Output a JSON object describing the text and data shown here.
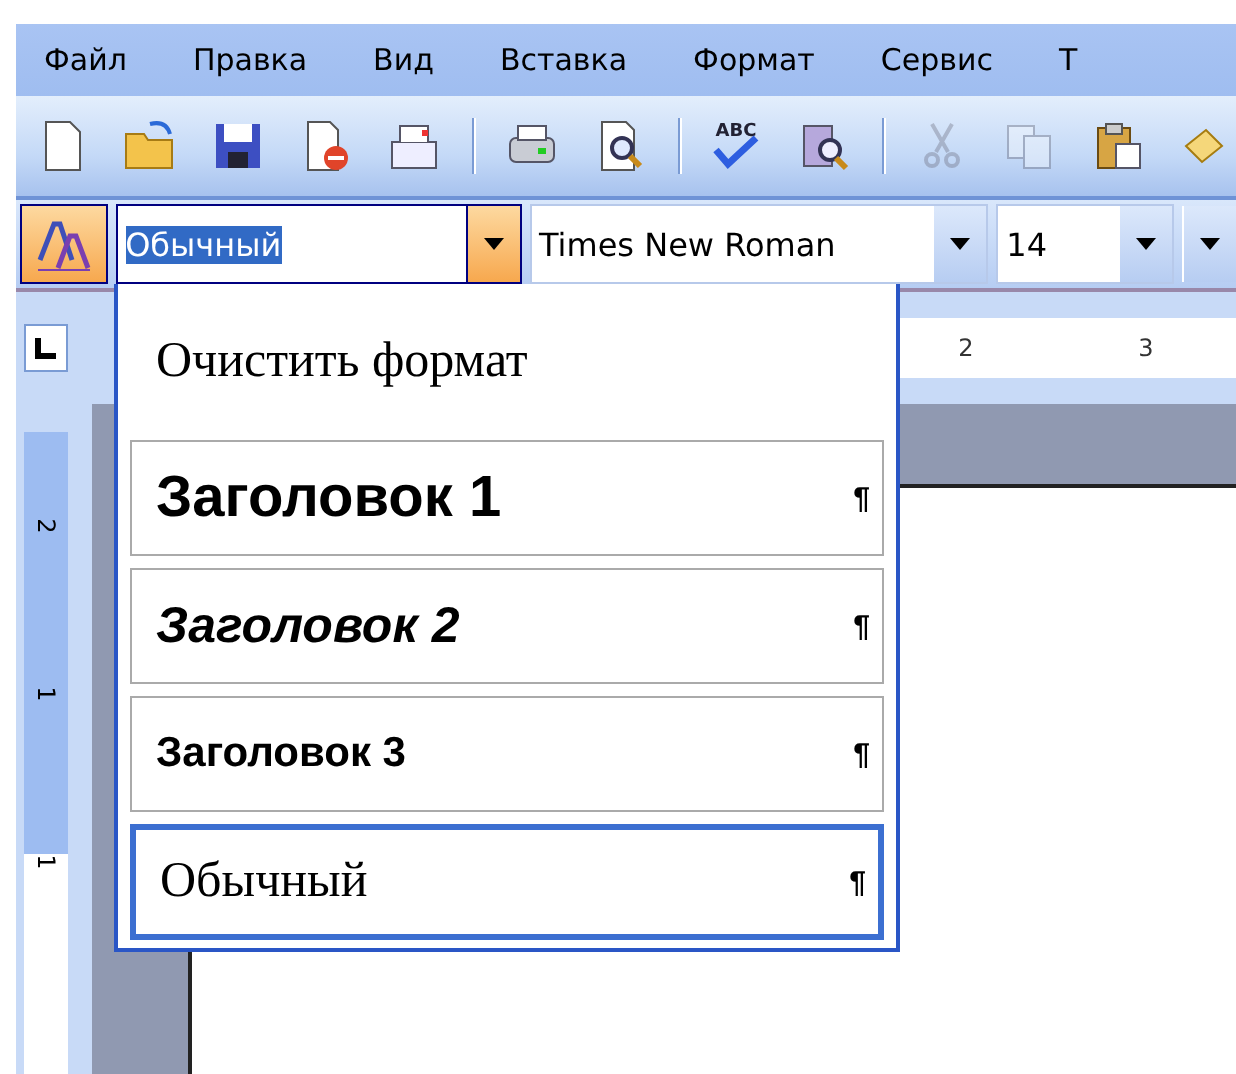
{
  "menu": [
    {
      "label": "Файл"
    },
    {
      "label": "Правка"
    },
    {
      "label": "Вид"
    },
    {
      "label": "Вставка"
    },
    {
      "label": "Формат"
    },
    {
      "label": "Сервис"
    },
    {
      "label": "Т"
    }
  ],
  "standard_toolbar": [
    {
      "kind": "new",
      "disabled": false
    },
    {
      "kind": "open",
      "disabled": false
    },
    {
      "kind": "save",
      "disabled": false
    },
    {
      "kind": "permission",
      "disabled": false
    },
    {
      "kind": "email",
      "disabled": false
    },
    {
      "kind": "separator"
    },
    {
      "kind": "print",
      "disabled": false
    },
    {
      "kind": "preview",
      "disabled": false
    },
    {
      "kind": "separator"
    },
    {
      "kind": "spelling",
      "label": "ABC",
      "disabled": false
    },
    {
      "kind": "research",
      "disabled": false
    },
    {
      "kind": "separator"
    },
    {
      "kind": "cut",
      "disabled": true
    },
    {
      "kind": "copy",
      "disabled": true
    },
    {
      "kind": "paste",
      "disabled": false
    },
    {
      "kind": "painter",
      "disabled": false
    }
  ],
  "formatting_toolbar": {
    "styles_button": {
      "pressed": true
    },
    "style_box": {
      "value": "Обычный",
      "open": true
    },
    "font_box": {
      "value": "Times New Roman"
    },
    "size_box": {
      "value": "14"
    }
  },
  "style_list": [
    {
      "kind": "clear",
      "label": "Очистить формат",
      "selected": false
    },
    {
      "kind": "heading1",
      "label": "Заголовок 1",
      "mark": "¶",
      "selected": false
    },
    {
      "kind": "heading2",
      "label": "Заголовок 2",
      "mark": "¶",
      "selected": false
    },
    {
      "kind": "heading3",
      "label": "Заголовок 3",
      "mark": "¶",
      "selected": false
    },
    {
      "kind": "normal",
      "label": "Обычный",
      "mark": "¶",
      "selected": true
    }
  ],
  "horizontal_ruler": {
    "labels": [
      "2",
      "3"
    ]
  },
  "vertical_ruler": {
    "labels": [
      "2",
      "1",
      "1"
    ]
  }
}
